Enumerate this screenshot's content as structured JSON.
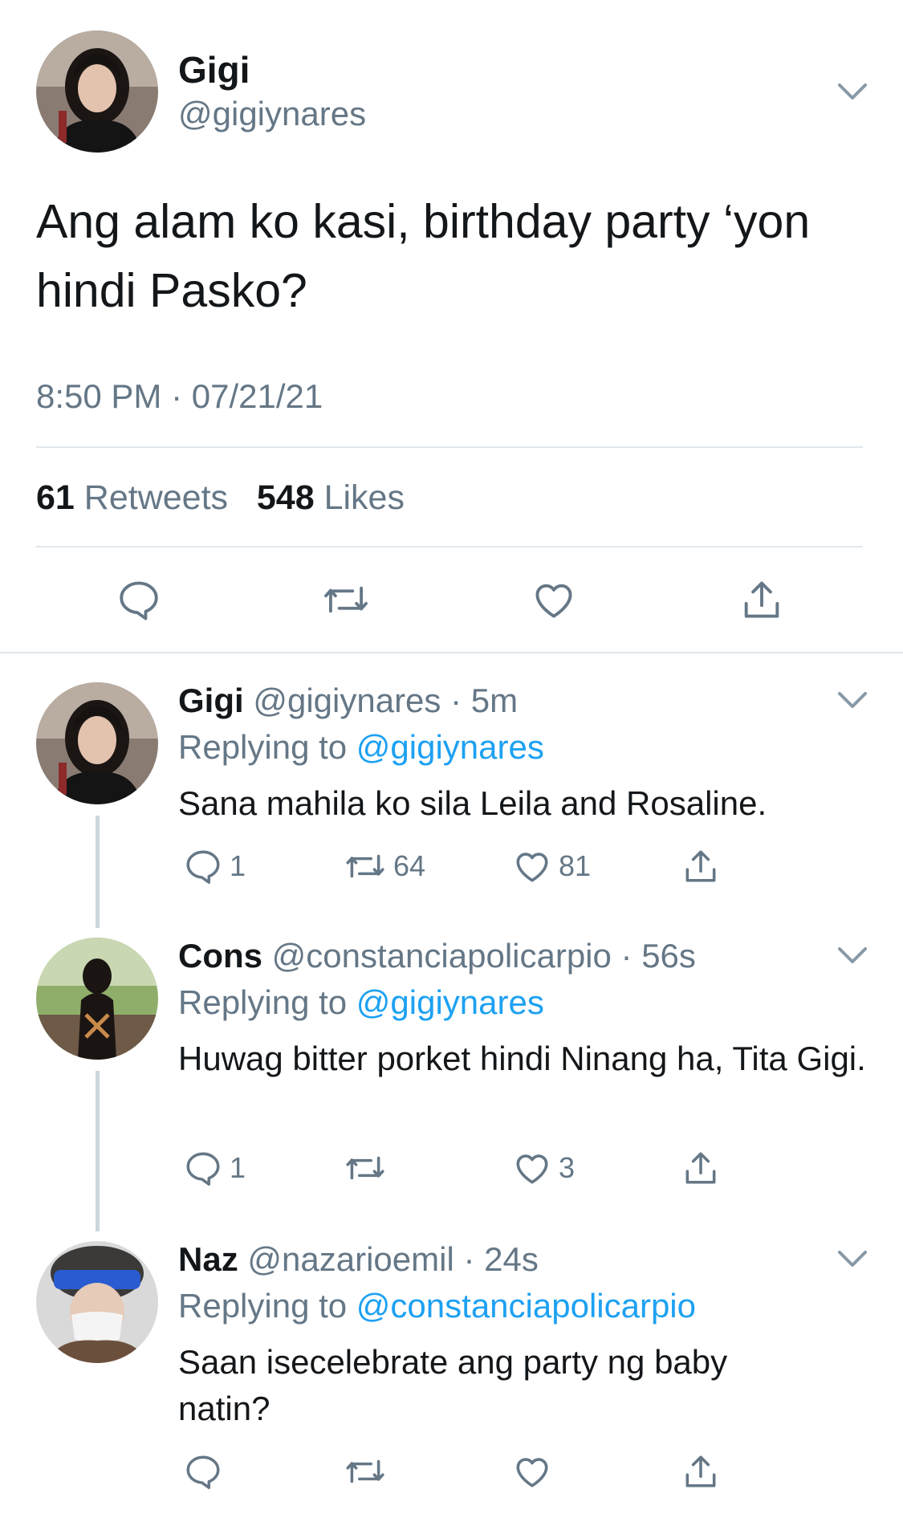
{
  "tweet": {
    "name": "Gigi",
    "handle": "@gigiynares",
    "text": "Ang alam ko kasi, birthday party ‘yon hindi Pasko?",
    "time": "8:50 PM",
    "sep": "·",
    "date": "07/21/21",
    "retweets_count": "61",
    "retweets_label": "Retweets",
    "likes_count": "548",
    "likes_label": "Likes"
  },
  "replies": [
    {
      "name": "Gigi",
      "handle": "@gigiynares",
      "age": "5m",
      "replying_prefix": "Replying to",
      "replying_to": "@gigiynares",
      "text": "Sana mahila ko sila Leila and Rosaline.",
      "reply_count": "1",
      "retweet_count": "64",
      "like_count": "81"
    },
    {
      "name": "Cons",
      "handle": "@constanciapolicarpio",
      "age": "56s",
      "replying_prefix": "Replying to",
      "replying_to": "@gigiynares",
      "text": "Huwag bitter porket hindi Ninang ha, Tita Gigi.",
      "reply_count": "1",
      "retweet_count": "",
      "like_count": "3"
    },
    {
      "name": "Naz",
      "handle": "@nazarioemil",
      "age": "24s",
      "replying_prefix": "Replying to",
      "replying_to": "@constanciapolicarpio",
      "text": "Saan isecelebrate ang party ng baby natin?",
      "reply_count": "",
      "retweet_count": "",
      "like_count": ""
    }
  ],
  "colors": {
    "accent": "#1da1f2",
    "secondary_text": "#657786",
    "divider": "#e1e8ed",
    "thread_line": "#ccd6dd"
  }
}
